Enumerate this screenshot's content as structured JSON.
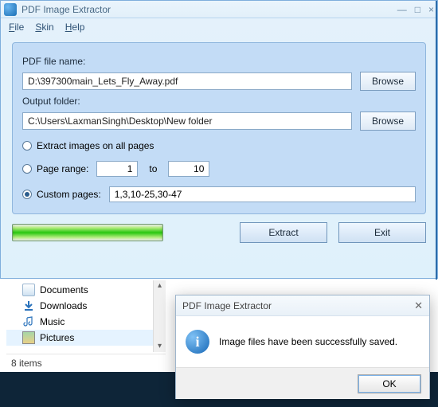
{
  "window": {
    "title": "PDF Image Extractor",
    "sys": {
      "min": "—",
      "max": "□",
      "close": "×"
    }
  },
  "menu": {
    "file": "File",
    "skin": "Skin",
    "help": "Help"
  },
  "form": {
    "pdf_label": "PDF file name:",
    "pdf_value": "D:\\397300main_Lets_Fly_Away.pdf",
    "browse1": "Browse",
    "out_label": "Output folder:",
    "out_value": "C:\\Users\\LaxmanSingh\\Desktop\\New folder",
    "browse2": "Browse",
    "opt_all": "Extract images on all pages",
    "opt_range": "Page range:",
    "range_from": "1",
    "range_to_label": "to",
    "range_to": "10",
    "opt_custom": "Custom pages:",
    "custom_value": "1,3,10-25,30-47"
  },
  "actions": {
    "extract": "Extract",
    "exit": "Exit"
  },
  "explorer": {
    "items": [
      {
        "label": "Documents"
      },
      {
        "label": "Downloads"
      },
      {
        "label": "Music"
      },
      {
        "label": "Pictures"
      }
    ],
    "status": "8 items"
  },
  "msg": {
    "title": "PDF Image Extractor",
    "body": "Image files have been successfully saved.",
    "ok": "OK"
  }
}
